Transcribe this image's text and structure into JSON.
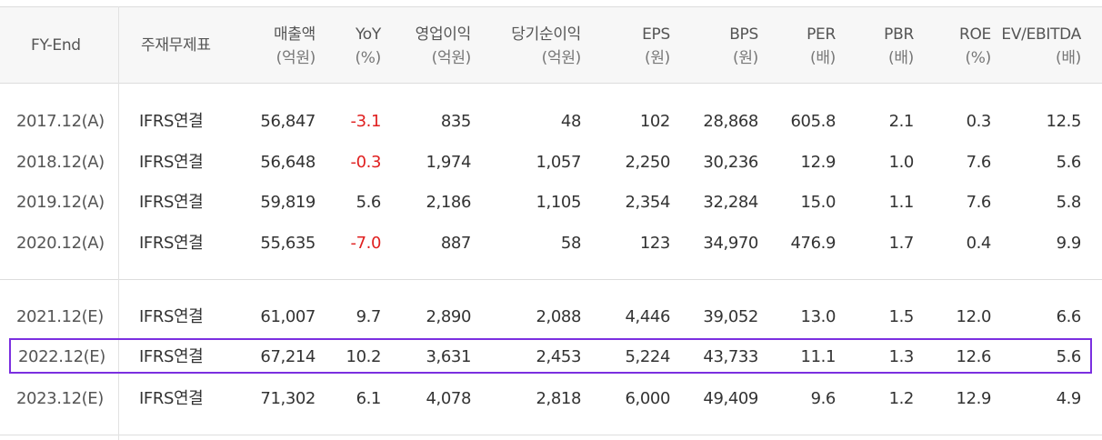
{
  "colors": {
    "negative": "#e02020",
    "highlight_border": "#7b2fe0",
    "header_bg": "#f7f7f7"
  },
  "header": {
    "fy_end": "FY-End",
    "statement": "주재무제표",
    "revenue": "매출액",
    "revenue_unit": "(억원)",
    "yoy": "YoY",
    "yoy_unit": "(%)",
    "op_income": "영업이익",
    "op_income_unit": "(억원)",
    "net_income": "당기순이익",
    "net_income_unit": "(억원)",
    "eps": "EPS",
    "eps_unit": "(원)",
    "bps": "BPS",
    "bps_unit": "(원)",
    "per": "PER",
    "per_unit": "(배)",
    "pbr": "PBR",
    "pbr_unit": "(배)",
    "roe": "ROE",
    "roe_unit": "(%)",
    "ev": "EV/EBITDA",
    "ev_unit": "(배)"
  },
  "rows": [
    {
      "fy": "2017.12(A)",
      "stmt": "IFRS연결",
      "rev": "56,847",
      "yoy": "-3.1",
      "op": "835",
      "net": "48",
      "eps": "102",
      "bps": "28,868",
      "per": "605.8",
      "pbr": "2.1",
      "roe": "0.3",
      "ev": "12.5"
    },
    {
      "fy": "2018.12(A)",
      "stmt": "IFRS연결",
      "rev": "56,648",
      "yoy": "-0.3",
      "op": "1,974",
      "net": "1,057",
      "eps": "2,250",
      "bps": "30,236",
      "per": "12.9",
      "pbr": "1.0",
      "roe": "7.6",
      "ev": "5.6"
    },
    {
      "fy": "2019.12(A)",
      "stmt": "IFRS연결",
      "rev": "59,819",
      "yoy": "5.6",
      "op": "2,186",
      "net": "1,105",
      "eps": "2,354",
      "bps": "32,284",
      "per": "15.0",
      "pbr": "1.1",
      "roe": "7.6",
      "ev": "5.8"
    },
    {
      "fy": "2020.12(A)",
      "stmt": "IFRS연결",
      "rev": "55,635",
      "yoy": "-7.0",
      "op": "887",
      "net": "58",
      "eps": "123",
      "bps": "34,970",
      "per": "476.9",
      "pbr": "1.7",
      "roe": "0.4",
      "ev": "9.9"
    },
    {
      "fy": "2021.12(E)",
      "stmt": "IFRS연결",
      "rev": "61,007",
      "yoy": "9.7",
      "op": "2,890",
      "net": "2,088",
      "eps": "4,446",
      "bps": "39,052",
      "per": "13.0",
      "pbr": "1.5",
      "roe": "12.0",
      "ev": "6.6"
    },
    {
      "fy": "2022.12(E)",
      "stmt": "IFRS연결",
      "rev": "67,214",
      "yoy": "10.2",
      "op": "3,631",
      "net": "2,453",
      "eps": "5,224",
      "bps": "43,733",
      "per": "11.1",
      "pbr": "1.3",
      "roe": "12.6",
      "ev": "5.6"
    },
    {
      "fy": "2023.12(E)",
      "stmt": "IFRS연결",
      "rev": "71,302",
      "yoy": "6.1",
      "op": "4,078",
      "net": "2,818",
      "eps": "6,000",
      "bps": "49,409",
      "per": "9.6",
      "pbr": "1.2",
      "roe": "12.9",
      "ev": "4.9"
    }
  ]
}
